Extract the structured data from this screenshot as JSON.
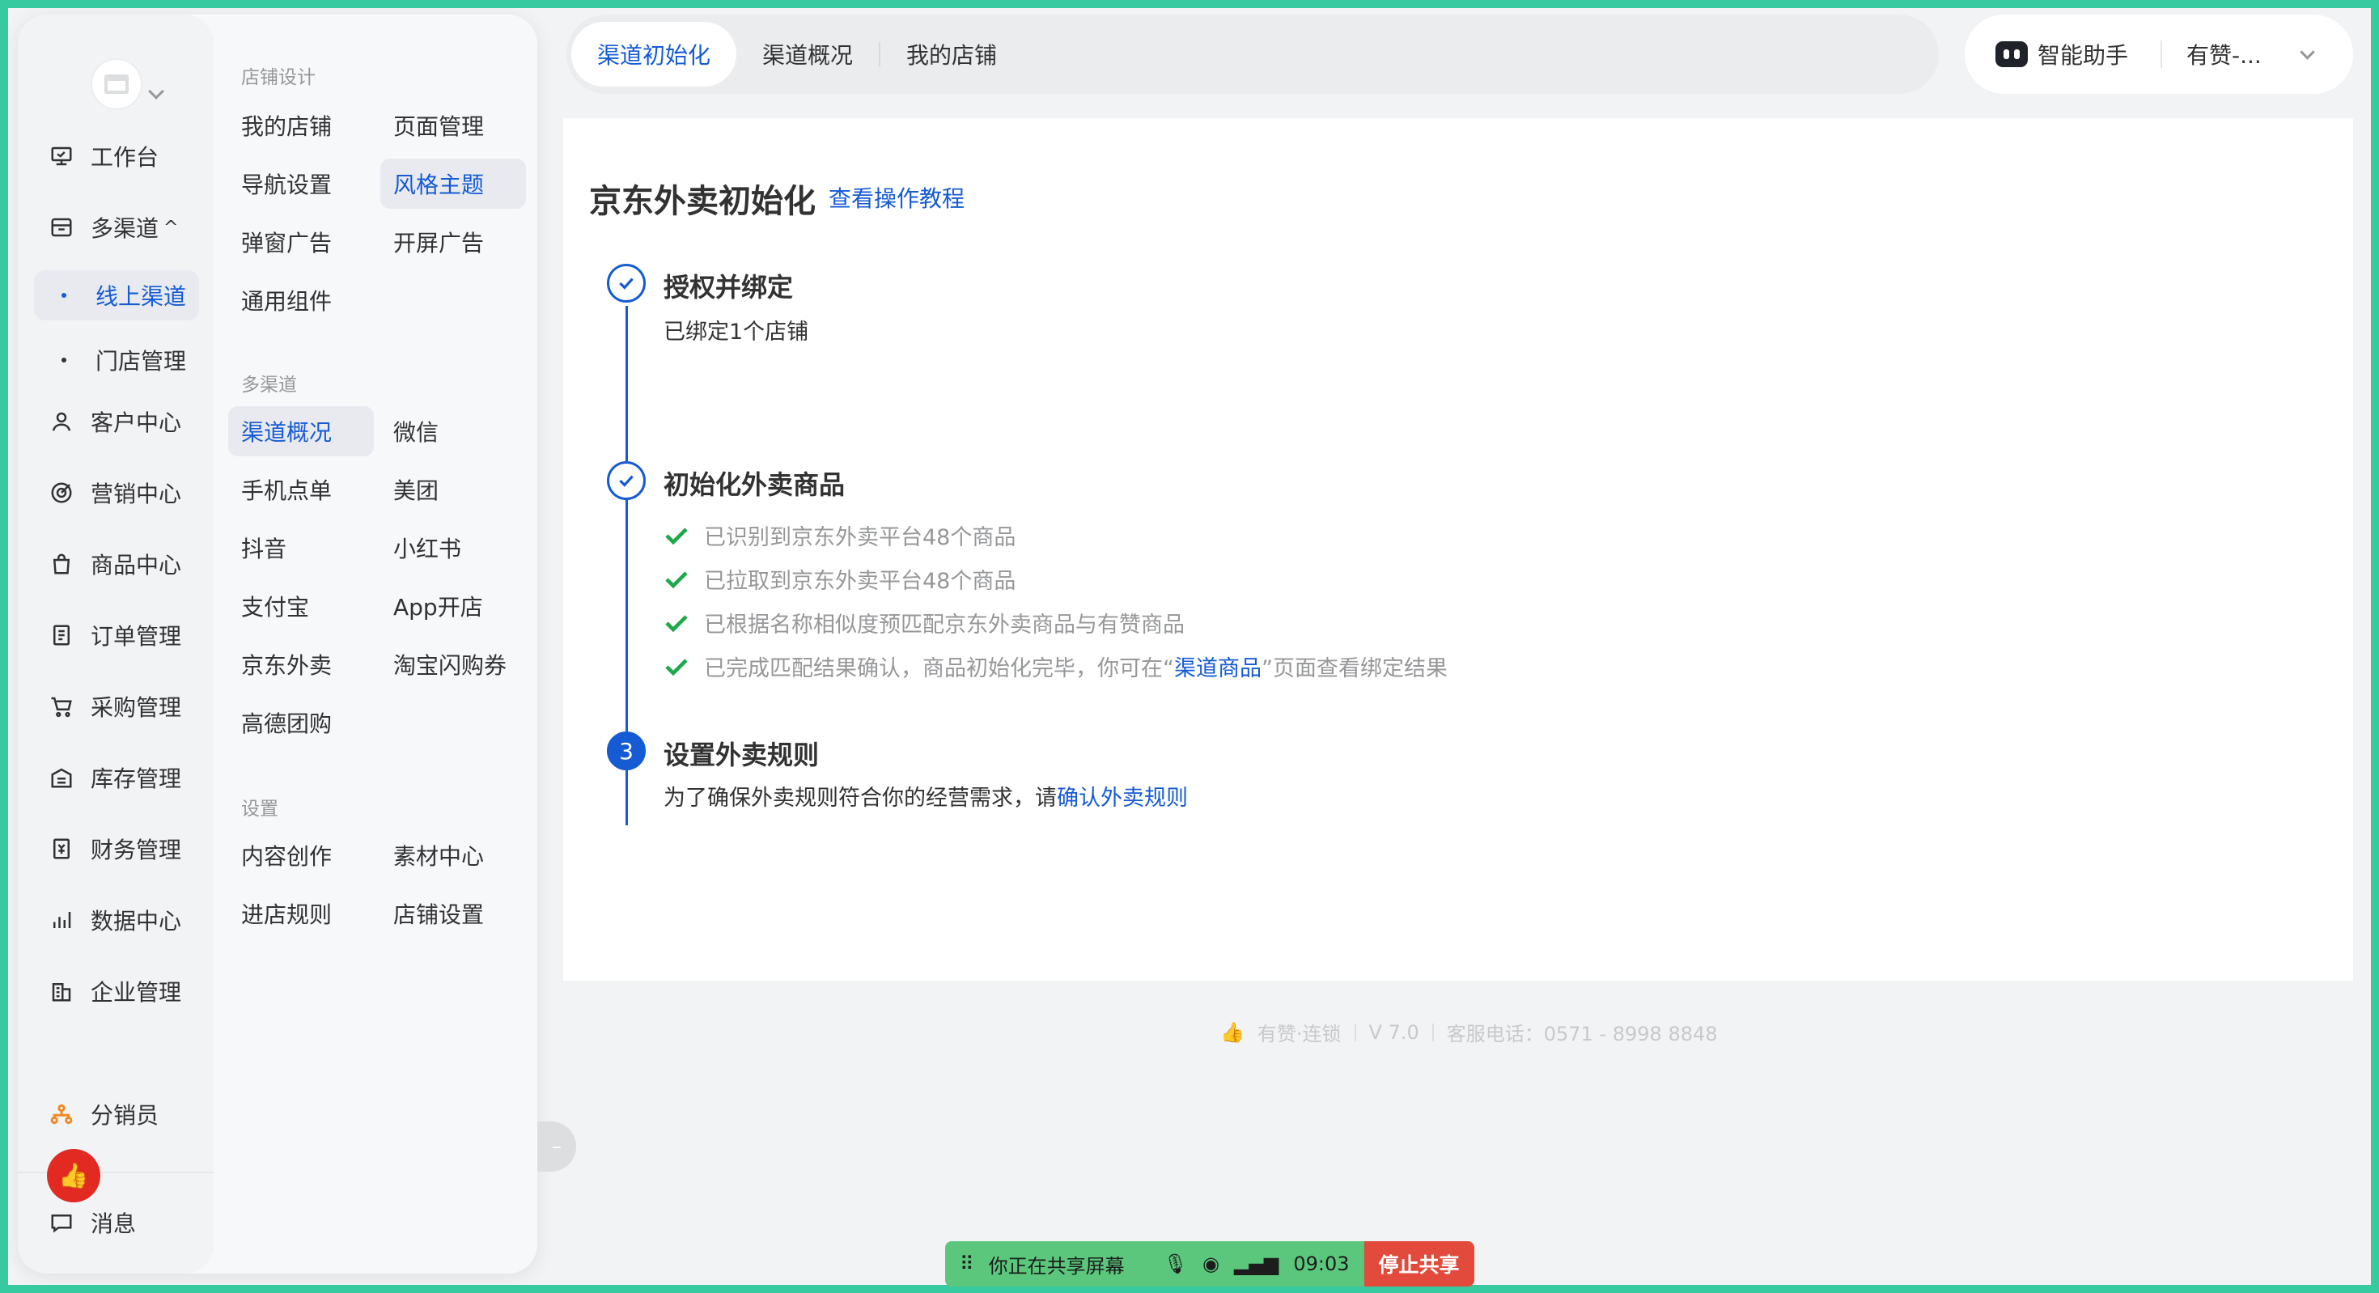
{
  "primary_nav": {
    "items": [
      {
        "label": "工作台",
        "icon": "workbench-icon"
      },
      {
        "label": "多渠道",
        "icon": "store-icon"
      },
      {
        "label": "线上渠道"
      },
      {
        "label": "门店管理"
      },
      {
        "label": "客户中心",
        "icon": "user-icon"
      },
      {
        "label": "营销中心",
        "icon": "target-icon"
      },
      {
        "label": "商品中心",
        "icon": "bag-icon"
      },
      {
        "label": "订单管理",
        "icon": "document-icon"
      },
      {
        "label": "采购管理",
        "icon": "cart-icon"
      },
      {
        "label": "库存管理",
        "icon": "warehouse-icon"
      },
      {
        "label": "财务管理",
        "icon": "finance-icon"
      },
      {
        "label": "数据中心",
        "icon": "bar-chart-icon"
      },
      {
        "label": "企业管理",
        "icon": "building-icon"
      },
      {
        "label": "分销员",
        "icon": "distributor-icon"
      },
      {
        "label": "消息",
        "icon": "message-icon"
      }
    ],
    "multi_channel_caret": "^"
  },
  "secondary_menu": {
    "sections": [
      {
        "title": "店铺设计",
        "items": [
          "我的店铺",
          "页面管理",
          "导航设置",
          "风格主题",
          "弹窗广告",
          "开屏广告",
          "通用组件"
        ]
      },
      {
        "title": "多渠道",
        "items": [
          "渠道概况",
          "微信",
          "手机点单",
          "美团",
          "抖音",
          "小红书",
          "支付宝",
          "App开店",
          "京东外卖",
          "淘宝闪购券",
          "高德团购"
        ]
      },
      {
        "title": "设置",
        "items": [
          "内容创作",
          "素材中心",
          "进店规则",
          "店铺设置"
        ]
      }
    ]
  },
  "tabs": [
    "渠道初始化",
    "渠道概况",
    "我的店铺"
  ],
  "assistant": {
    "label": "智能助手",
    "account": "有赞-..."
  },
  "page": {
    "title": "京东外卖初始化",
    "tutorial_link": "查看操作教程",
    "steps": [
      {
        "title": "授权并绑定",
        "desc": "已绑定1个店铺"
      },
      {
        "title": "初始化外卖商品",
        "checks": [
          "已识别到京东外卖平台48个商品",
          "已拉取到京东外卖平台48个商品",
          "已根据名称相似度预匹配京东外卖商品与有赞商品"
        ],
        "last_check_prefix": "已完成匹配结果确认，商品初始化完毕，你可在“",
        "last_check_link": "渠道商品",
        "last_check_suffix": "”页面查看绑定结果"
      },
      {
        "number": "3",
        "title": "设置外卖规则",
        "desc_prefix": "为了确保外卖规则符合你的经营需求，请",
        "desc_link": "确认外卖规则"
      }
    ]
  },
  "footer": {
    "brand": "有赞·连锁",
    "version": "V 7.0",
    "phone": "客服电话：0571 - 8998 8848"
  },
  "share_bar": {
    "label": "你正在共享屏幕",
    "time": "09:03",
    "stop": "停止共享"
  },
  "colors": {
    "accent": "#155bd4",
    "share_green": "#5bc77c",
    "stop_red": "#e24a3b",
    "check_green": "#1fa84a"
  }
}
